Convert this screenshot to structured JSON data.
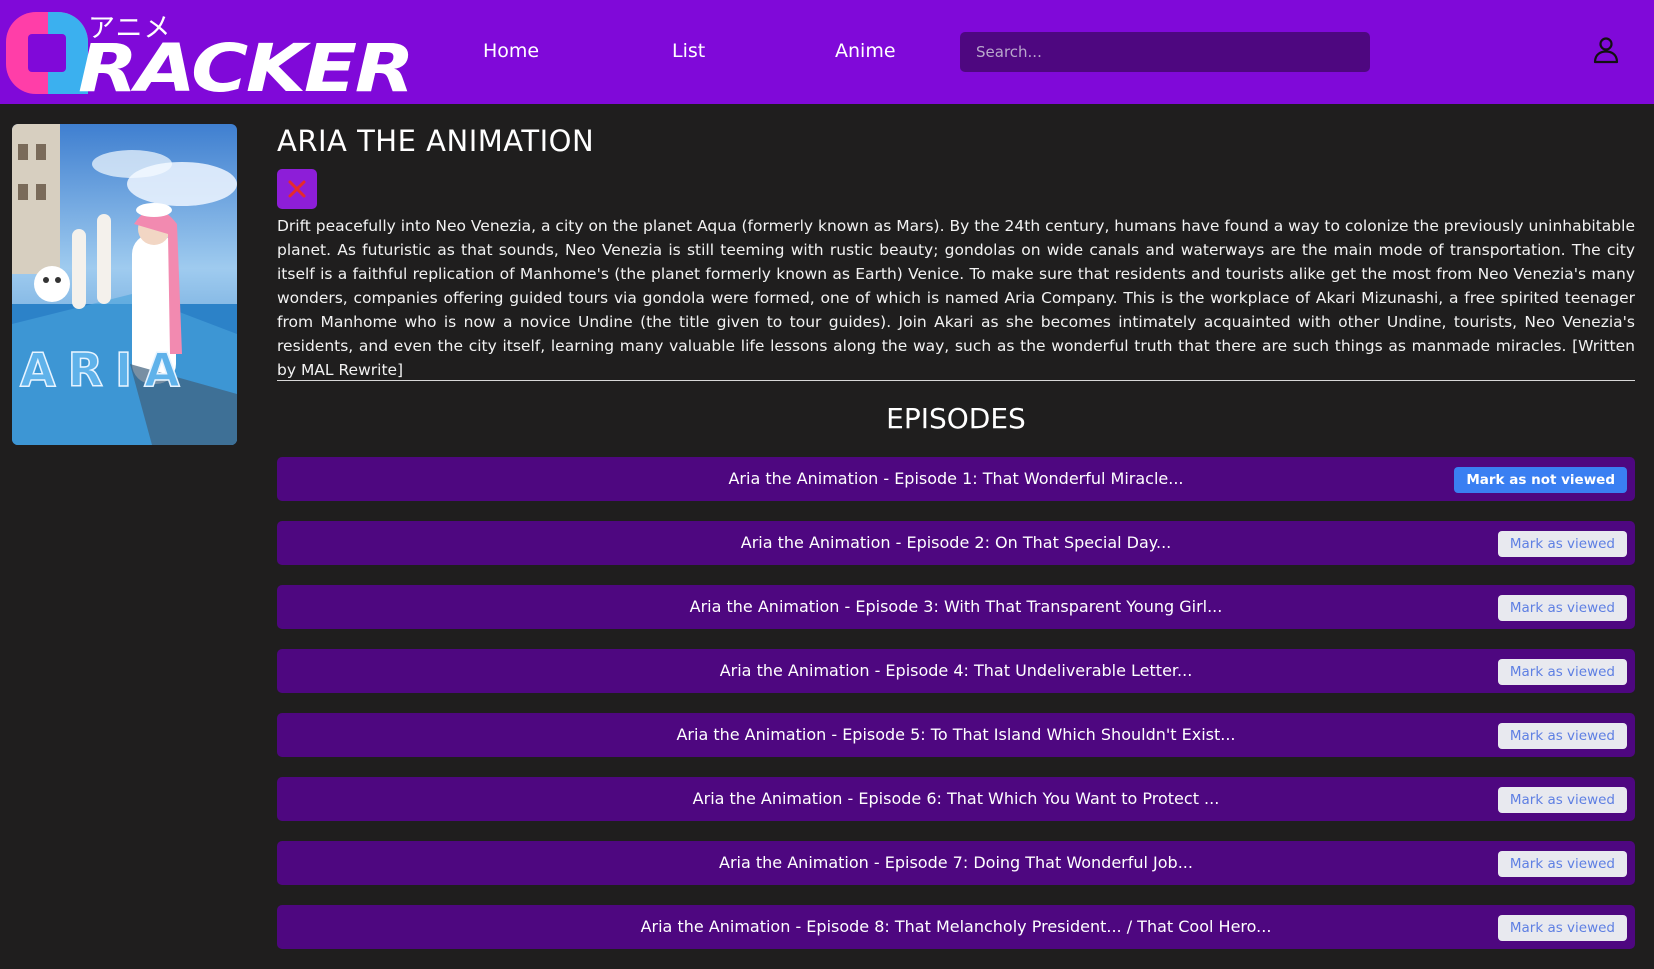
{
  "brand": {
    "kana": "アニメ",
    "word": "RACKER",
    "colors": {
      "cyan": "#3bb0ef",
      "pink": "#ff3ea8",
      "nav": "#8009d9"
    }
  },
  "nav": {
    "links": [
      "Home",
      "List",
      "Anime"
    ],
    "search_placeholder": "Search...",
    "user_icon": "user-icon"
  },
  "anime": {
    "title": "ARIA THE ANIMATION",
    "poster_text": "ARIA",
    "remove_icon": "close-icon",
    "synopsis": "Drift peacefully into Neo Venezia, a city on the planet Aqua (formerly known as Mars). By the 24th century, humans have found a way to colonize the previously uninhabitable planet. As futuristic as that sounds, Neo Venezia is still teeming with rustic beauty; gondolas on wide canals and waterways are the main mode of transportation. The city itself is a faithful replication of Manhome's (the planet formerly known as Earth) Venice. To make sure that residents and tourists alike get the most from Neo Venezia's many wonders, companies offering guided tours via gondola were formed, one of which is named Aria Company. This is the workplace of Akari Mizunashi, a free spirited teenager from Manhome who is now a novice Undine (the title given to tour guides). Join Akari as she becomes intimately acquainted with other Undine, tourists, Neo Venezia's residents, and even the city itself, learning many valuable life lessons along the way, such as the wonderful truth that there are such things as manmade miracles. [Written by MAL Rewrite]"
  },
  "episodes": {
    "heading": "EPISODES",
    "items": [
      {
        "title": "Aria the Animation - Episode 1: That Wonderful Miracle...",
        "button": "Mark as not viewed",
        "viewed": true
      },
      {
        "title": "Aria the Animation - Episode 2: On That Special Day...",
        "button": "Mark as viewed",
        "viewed": false
      },
      {
        "title": "Aria the Animation - Episode 3: With That Transparent Young Girl...",
        "button": "Mark as viewed",
        "viewed": false
      },
      {
        "title": "Aria the Animation - Episode 4: That Undeliverable Letter...",
        "button": "Mark as viewed",
        "viewed": false
      },
      {
        "title": "Aria the Animation - Episode 5: To That Island Which Shouldn't Exist...",
        "button": "Mark as viewed",
        "viewed": false
      },
      {
        "title": "Aria the Animation - Episode 6: That Which You Want to Protect ...",
        "button": "Mark as viewed",
        "viewed": false
      },
      {
        "title": "Aria the Animation - Episode 7: Doing That Wonderful Job...",
        "button": "Mark as viewed",
        "viewed": false
      },
      {
        "title": "Aria the Animation - Episode 8: That Melancholy President... / That Cool Hero...",
        "button": "Mark as viewed",
        "viewed": false
      }
    ]
  }
}
